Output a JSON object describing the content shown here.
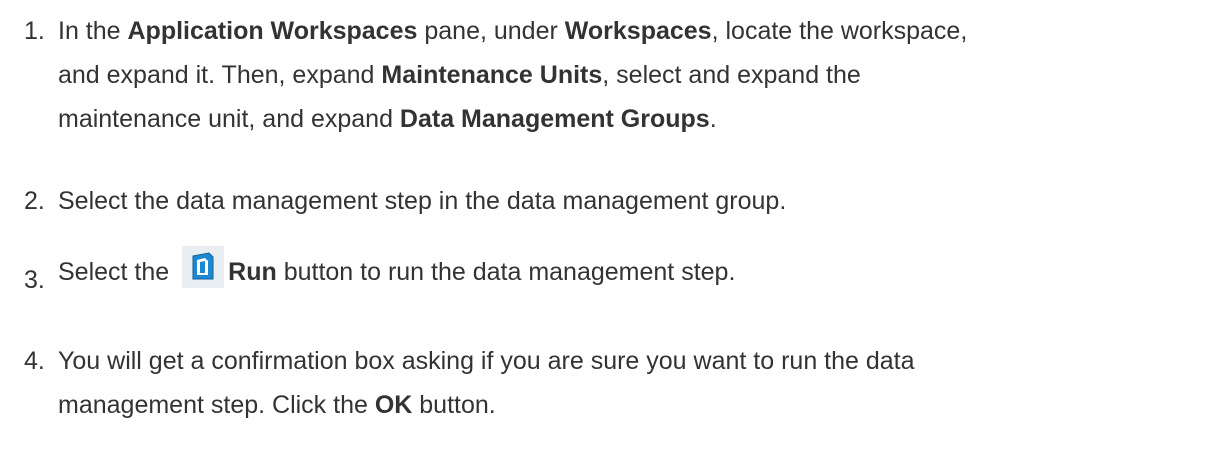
{
  "steps": [
    {
      "number": "1.",
      "lines": [
        {
          "t1": "In the ",
          "b1": "Application Workspaces",
          "t2": " pane, under ",
          "b2": "Workspaces",
          "t3": ", locate the workspace,"
        },
        {
          "t1": "and expand it. Then, expand  ",
          "b1": "Maintenance Units",
          "t2": ", select and expand the"
        },
        {
          "t1": "maintenance unit, and expand  ",
          "b1": "Data Management Groups",
          "t2": "."
        }
      ]
    },
    {
      "number": "2.",
      "text": "Select the data management step in the data management group."
    },
    {
      "number": "3.",
      "t1": "Select the ",
      "icon": "run-icon",
      "b1": "Run",
      "t2": " button to run the data management step."
    },
    {
      "number": "4.",
      "line1": "You will get a confirmation box asking if you are sure you want to run the data",
      "t1": "management step. Click the ",
      "b1": "OK",
      "t2": " button."
    }
  ],
  "colors": {
    "text": "#333333",
    "icon_blue": "#1e88d2",
    "icon_light": "#e9eef3"
  }
}
